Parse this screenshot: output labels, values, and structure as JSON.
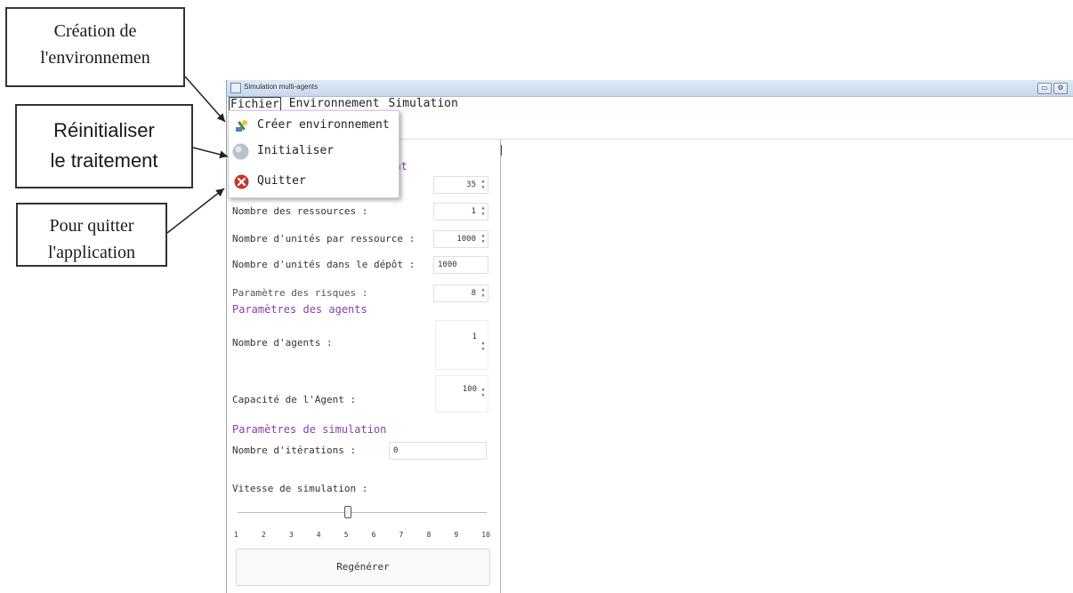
{
  "callouts": {
    "creation": [
      "Création de",
      "l'environnemen"
    ],
    "reinit": [
      "Réinitialiser",
      "le traitement"
    ],
    "quit": [
      "Pour quitter",
      "l'application"
    ]
  },
  "window": {
    "title": "Simulation multi-agents",
    "controls": [
      "▭",
      "⚙"
    ]
  },
  "menu": {
    "items": [
      "Fichier",
      "Environnement",
      "Simulation"
    ],
    "dropdown": [
      {
        "label": "Créer environnement",
        "icon": "create-environment-icon"
      },
      {
        "label": "Initialiser",
        "icon": "initialize-icon"
      },
      {
        "label": "Quitter",
        "icon": "quit-icon"
      }
    ]
  },
  "panel": {
    "env_section_fragment": "ment",
    "row1_label_fragment": ":",
    "row1_value": "35",
    "resources_label": "Nombre des ressources :",
    "resources_value": "1",
    "units_label": "Nombre d'unités par ressource :",
    "units_value": "1000",
    "depot_label": "Nombre d'unités dans le dépôt :",
    "depot_value": "1000",
    "risk_label": "Paramètre des risques :",
    "risk_value": "8",
    "agents_section": "Paramètres des agents",
    "agents_count_label": "Nombre d'agents :",
    "agents_count_value": "1",
    "agent_capacity_label": "Capacité de l'Agent :",
    "agent_capacity_value": "100",
    "sim_section": "Paramètres de simulation",
    "iterations_label": "Nombre d'itérations :",
    "iterations_value": "0",
    "speed_label": "Vitesse de simulation :",
    "speed_value": 5,
    "speed_ticks": [
      "1",
      "2",
      "3",
      "4",
      "5",
      "6",
      "7",
      "8",
      "9",
      "10"
    ],
    "regen_button": "Regénérer"
  },
  "colors": {
    "section_title": "#8a3ea8",
    "quit_icon": "#c0392b",
    "title_bar": "#dfe9f6"
  }
}
